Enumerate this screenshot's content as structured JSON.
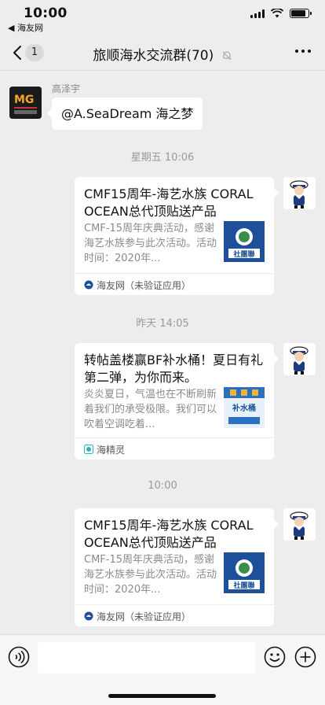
{
  "status_bar": {
    "time": "10:00",
    "back_app": "◀ 海友网",
    "icons": [
      "signal-icon",
      "wifi-icon",
      "battery-icon"
    ]
  },
  "nav": {
    "unread_count": "1",
    "title": "旅顺海水交流群(70)",
    "icons": [
      "back-chevron-icon",
      "mute-bell-icon",
      "more-dots-icon"
    ]
  },
  "messages": {
    "first": {
      "sender": "高泽宇",
      "text": "@A.SeaDream 海之梦",
      "avatar_text": "MG"
    },
    "ts1": "星期五 10:06",
    "card1": {
      "title": "CMF15周年-海艺水族 CORAL OCEAN总代顶贴送产品",
      "desc": "CMF-15周年庆典活动，感谢海艺水族参与此次活动。活动时间：2020年...",
      "thumb_text": "社團聯",
      "source": "海友网（未验证应用）"
    },
    "ts2": "昨天 14:05",
    "card2": {
      "title": "转帖盖楼赢BF补水桶！夏日有礼第二弹，为你而来。",
      "desc": "炎炎夏日，气温也在不断刷新着我们的承受极限。我们可以吹着空调吃着...",
      "thumb_text": "补水桶",
      "source": "海精灵"
    },
    "ts3": "10:00",
    "card3": {
      "title": "CMF15周年-海艺水族 CORAL OCEAN总代顶贴送产品",
      "desc": "CMF-15周年庆典活动，感谢海艺水族参与此次活动。活动时间：2020年...",
      "thumb_text": "社團聯",
      "source": "海友网（未验证应用）"
    }
  },
  "input_bar": {
    "placeholder": "",
    "icons": [
      "voice-icon",
      "emoji-icon",
      "plus-icon"
    ]
  },
  "colors": {
    "background": "#ededed",
    "bubble": "#ffffff",
    "timestamp": "#9a9a9a",
    "card_thumb_blue": "#1e4f9a"
  }
}
